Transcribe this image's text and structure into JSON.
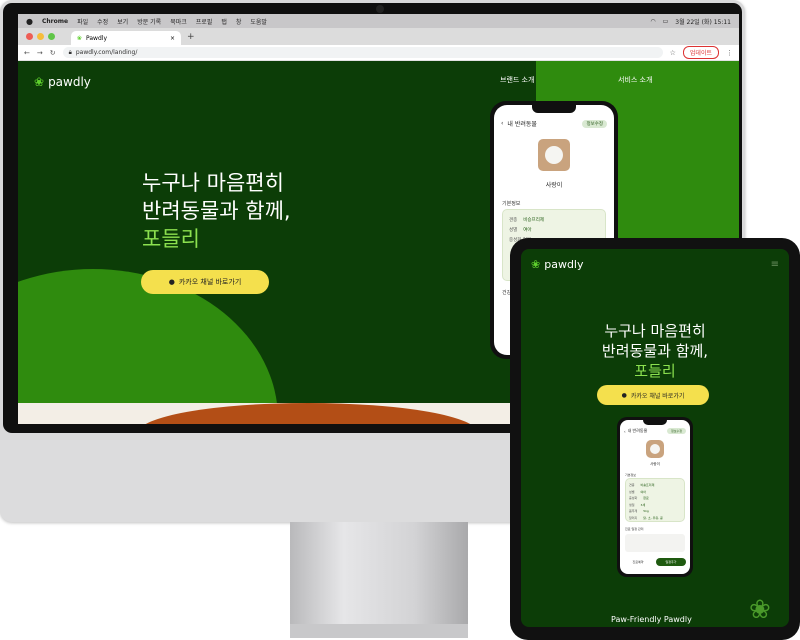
{
  "menubar": {
    "apple": "",
    "app": "Chrome",
    "items": [
      "파일",
      "수정",
      "보기",
      "방문 기록",
      "북마크",
      "프로필",
      "탭",
      "창",
      "도움말"
    ],
    "clock": "3월 22일 (화) 15:11"
  },
  "browser": {
    "tab_title": "Pawdly",
    "tab_close": "×",
    "new_tab": "+",
    "url": "pawdly.com/landing/",
    "update_button": "업데이트",
    "nav": {
      "back": "←",
      "forward": "→",
      "reload": "↻"
    }
  },
  "landing": {
    "logo": "pawdly",
    "nav": [
      "브랜드 소개",
      "서비스 소개"
    ],
    "headline_line1": "누구나 마음편히",
    "headline_line2": "반려동물과 함께,",
    "headline_accent": "포들리",
    "cta": "카카오 채널 바로가기"
  },
  "phone_app": {
    "title": "내 반려동물",
    "edit": "정보수정",
    "pet_name": "사랑이",
    "basic_info": "기본정보",
    "rows": [
      {
        "label": "견종",
        "value": "비숑프리제"
      },
      {
        "label": "성별",
        "value": "여아"
      },
      {
        "label": "중성화 여부",
        "value": ""
      }
    ],
    "section2": "건강"
  },
  "ipad": {
    "logo": "pawdly",
    "menu": "≡",
    "headline_line1": "누구나 마음편히",
    "headline_line2": "반려동물과 함께,",
    "headline_accent": "포들리",
    "cta": "카카오 채널 바로가기",
    "footer": "Paw-Friendly Pawdly",
    "phone": {
      "title": "내 반려동물",
      "edit": "정보수정",
      "pet_name": "사랑이",
      "basic_info": "기본정보",
      "rows": [
        {
          "label": "견종",
          "value": "비숑프리제"
        },
        {
          "label": "성별",
          "value": "여아"
        },
        {
          "label": "중성화",
          "value": "완료"
        },
        {
          "label": "생일",
          "value": "3세"
        },
        {
          "label": "몸무게",
          "value": "5kg"
        },
        {
          "label": "알러지",
          "value": "닭, 소, 우유, 콩"
        }
      ],
      "section2": "진료 일정 관리",
      "button_left": "진료예약",
      "button_right": "일정추가"
    }
  },
  "colors": {
    "dark_green": "#0c3d07",
    "mid_green": "#2f8b0e",
    "accent_green": "#8ce14f",
    "kakao_yellow": "#f4e04d"
  }
}
